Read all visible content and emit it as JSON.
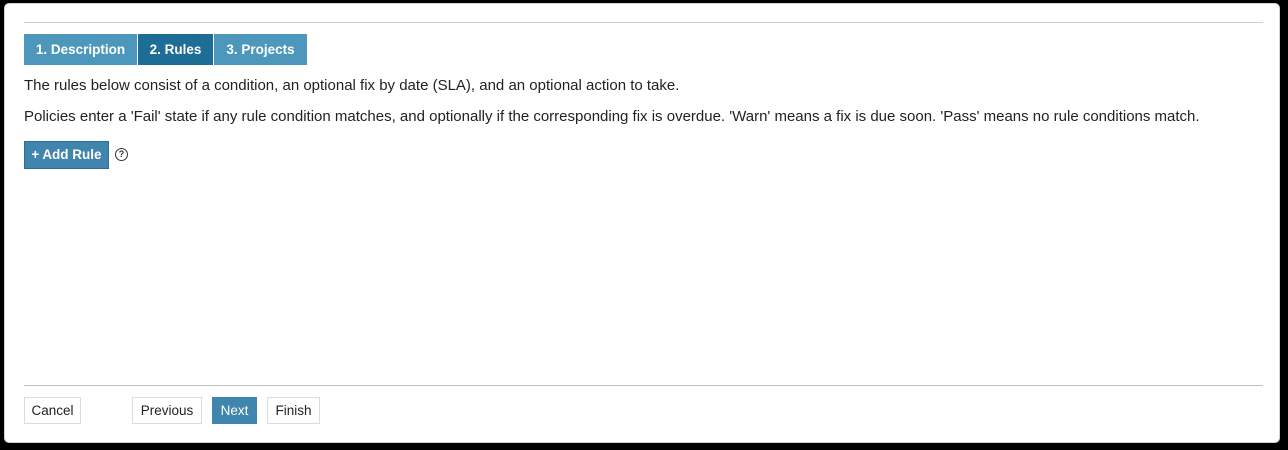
{
  "wizard": {
    "tabs": [
      {
        "label": "1. Description",
        "active": false
      },
      {
        "label": "2. Rules",
        "active": true
      },
      {
        "label": "3. Projects",
        "active": false
      }
    ]
  },
  "content": {
    "intro": "The rules below consist of a condition, an optional fix by date (SLA), and an optional action to take.",
    "states": "Policies enter a 'Fail' state if any rule condition matches, and optionally if the corresponding fix is overdue. 'Warn' means a fix is due soon. 'Pass' means no rule conditions match.",
    "add_rule_icon": "+",
    "add_rule_label": "Add Rule",
    "help_icon": "?"
  },
  "footer": {
    "cancel_label": "Cancel",
    "previous_label": "Previous",
    "next_label": "Next",
    "finish_label": "Finish"
  },
  "colors": {
    "tab": "#4d97bd",
    "tab_active": "#1e6d97",
    "primary_button": "#3f85ad"
  }
}
